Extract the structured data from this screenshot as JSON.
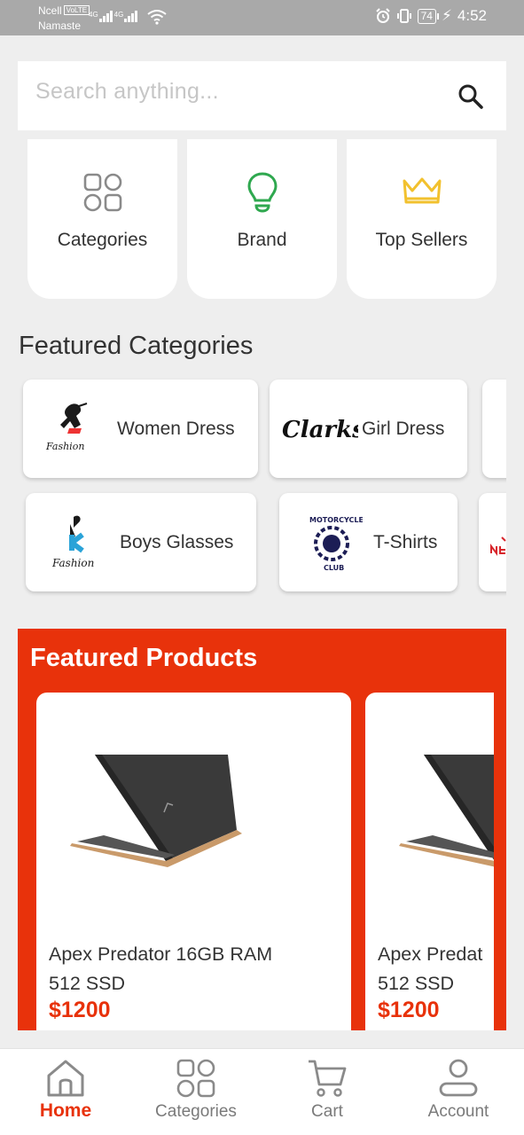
{
  "status_bar": {
    "carrier": "Ncell",
    "volte": "VoLTE",
    "network_name": "Namaste",
    "signal_label_1": "4G",
    "signal_label_2": "4G",
    "battery": "74",
    "time": "4:52"
  },
  "search": {
    "placeholder": "Search anything..."
  },
  "quick_tiles": [
    {
      "label": "Categories",
      "icon": "grid-icon"
    },
    {
      "label": "Brand",
      "icon": "bulb-icon"
    },
    {
      "label": "Top Sellers",
      "icon": "crown-icon"
    }
  ],
  "featured_categories": {
    "title": "Featured Categories",
    "items": [
      {
        "label": "Women Dress",
        "logo": "fashion-logo"
      },
      {
        "label": "Girl Dress",
        "logo": "clarks-logo",
        "logo_text": "Clarks"
      },
      {
        "label": "Boys Glasses",
        "logo": "fashion-k-logo"
      },
      {
        "label": "T-Shirts",
        "logo": "motorcycle-club-logo",
        "logo_text": "MOTORCYCLE CLUB"
      }
    ]
  },
  "featured_products": {
    "title": "Featured Products",
    "items": [
      {
        "name": "Apex Predator 16GB RAM\n512 SSD",
        "price": "$1200"
      },
      {
        "name": "Apex Predat\n512 SSD",
        "price": "$1200"
      }
    ]
  },
  "bottom_nav": [
    {
      "label": "Home",
      "icon": "home-icon",
      "active": true
    },
    {
      "label": "Categories",
      "icon": "grid-icon",
      "active": false
    },
    {
      "label": "Cart",
      "icon": "cart-icon",
      "active": false
    },
    {
      "label": "Account",
      "icon": "account-icon",
      "active": false
    }
  ],
  "colors": {
    "accent": "#e8320b",
    "status_bar": "#a9a9a9",
    "icon_grid": "#8a8a8a",
    "icon_bulb": "#2fa84f",
    "icon_crown": "#f2c12e"
  }
}
